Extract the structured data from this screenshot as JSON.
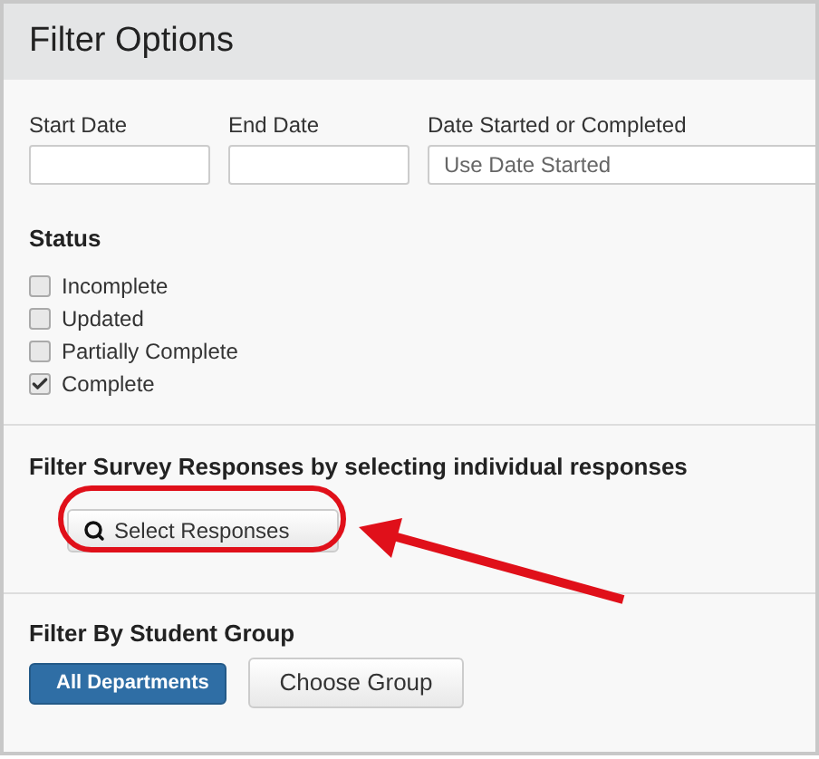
{
  "title": "Filter Options",
  "date_fields": [
    {
      "label": "Start Date"
    },
    {
      "label": "End Date"
    },
    {
      "label": "Date Started or Completed",
      "placeholder": "Use Date Started"
    }
  ],
  "status": {
    "heading": "Status",
    "options": [
      {
        "label": "Incomplete",
        "checked": false
      },
      {
        "label": "Updated",
        "checked": false
      },
      {
        "label": "Partially Complete",
        "checked": false
      },
      {
        "label": "Complete",
        "checked": true
      }
    ]
  },
  "responses": {
    "heading": "Filter Survey Responses by selecting individual responses",
    "button": "Select Responses"
  },
  "group": {
    "heading": "Filter By Student Group",
    "breadcrumb": "All Departments",
    "button": "Choose Group"
  }
}
